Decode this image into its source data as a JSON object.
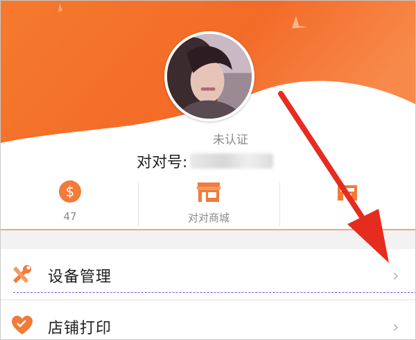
{
  "profile": {
    "verify_status": "未认证",
    "account_label": "对对号:"
  },
  "stats": [
    {
      "icon": "coin-icon",
      "label": "47"
    },
    {
      "icon": "shop-icon",
      "label": "对对商城"
    },
    {
      "icon": "store-icon",
      "label": ""
    }
  ],
  "menu": [
    {
      "icon": "tools-icon",
      "label": "设备管理"
    },
    {
      "icon": "heart-icon",
      "label": "店铺打印"
    }
  ],
  "colors": {
    "accent": "#f06a2c",
    "accent_light": "#f8a04e",
    "annotation_arrow": "#e52c1f"
  }
}
